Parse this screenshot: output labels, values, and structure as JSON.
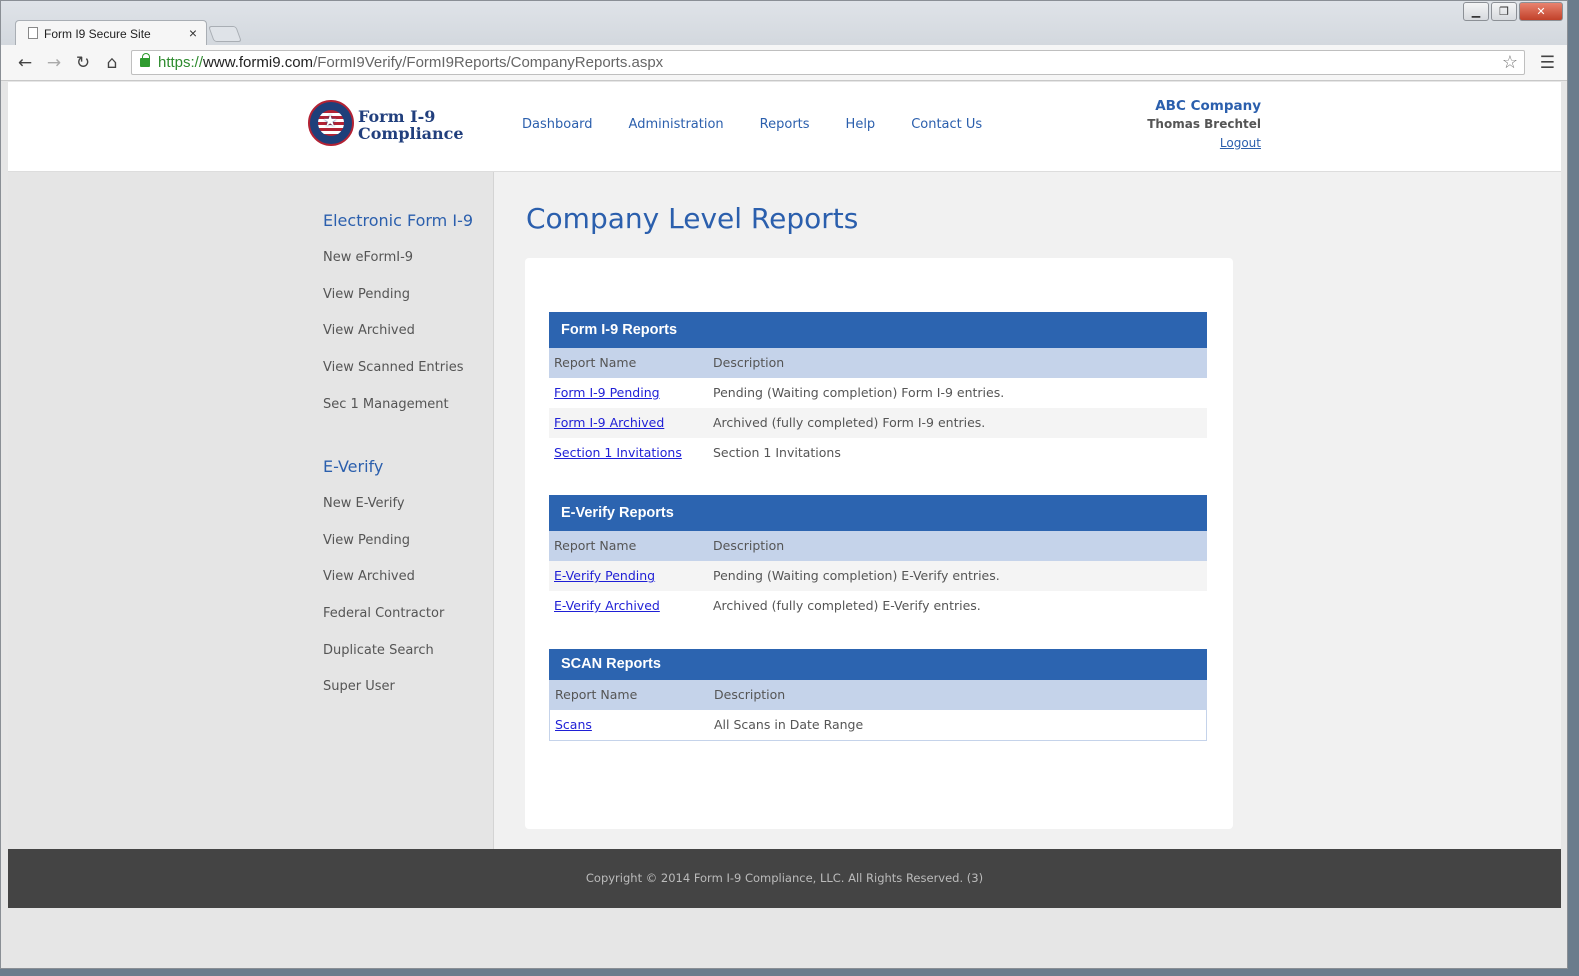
{
  "browser": {
    "tab_title": "Form I9 Secure Site",
    "tab_close": "×",
    "url_scheme": "https://",
    "url_host": "www.formi9.com",
    "url_path": "/FormI9Verify/FormI9Reports/CompanyReports.aspx",
    "window_controls": [
      "▁",
      "❐",
      "✕"
    ],
    "nav_icons": [
      "back-arrow-icon",
      "forward-arrow-icon",
      "reload-icon",
      "home-icon",
      "star-icon",
      "menu-icon"
    ]
  },
  "header": {
    "logo_line1": "Form I-9",
    "logo_line2": "Compliance",
    "nav": [
      "Dashboard",
      "Administration",
      "Reports",
      "Help",
      "Contact Us"
    ],
    "company": "ABC Company",
    "user": "Thomas Brechtel",
    "logout": "Logout"
  },
  "sidebar": {
    "eform_heading": "Electronic Form I-9",
    "eform_items": [
      "New eFormI-9",
      "View Pending",
      "View Archived",
      "View Scanned Entries",
      "Sec 1 Management"
    ],
    "everify_heading": "E-Verify",
    "everify_items": [
      "New E-Verify",
      "View Pending",
      "View Archived",
      "Federal Contractor",
      "Duplicate Search",
      "Super User"
    ]
  },
  "main": {
    "title": "Company Level Reports",
    "col_name": "Report Name",
    "col_desc": "Description",
    "i9": {
      "heading": "Form I-9 Reports",
      "rows": [
        {
          "name": "Form I-9 Pending",
          "desc": "Pending (Waiting completion) Form I-9 entries."
        },
        {
          "name": "Form I-9 Archived",
          "desc": "Archived (fully completed) Form I-9 entries."
        },
        {
          "name": "Section 1 Invitations",
          "desc": "Section 1 Invitations"
        }
      ]
    },
    "everify": {
      "heading": "E-Verify Reports",
      "rows": [
        {
          "name": "E-Verify Pending",
          "desc": "Pending (Waiting completion) E-Verify entries."
        },
        {
          "name": "E-Verify Archived",
          "desc": "Archived (fully completed) E-Verify entries."
        }
      ]
    },
    "scan": {
      "heading": "SCAN Reports",
      "rows": [
        {
          "name": "Scans",
          "desc": "All Scans in Date Range"
        }
      ]
    }
  },
  "footer": {
    "copyright": "Copyright © 2014 Form I-9 Compliance, LLC. All Rights Reserved. (3)"
  },
  "colors": {
    "brand_blue": "#2b5fad",
    "report_header": "#2c64b0",
    "column_header": "#c5d3ea",
    "footer": "#444444"
  }
}
